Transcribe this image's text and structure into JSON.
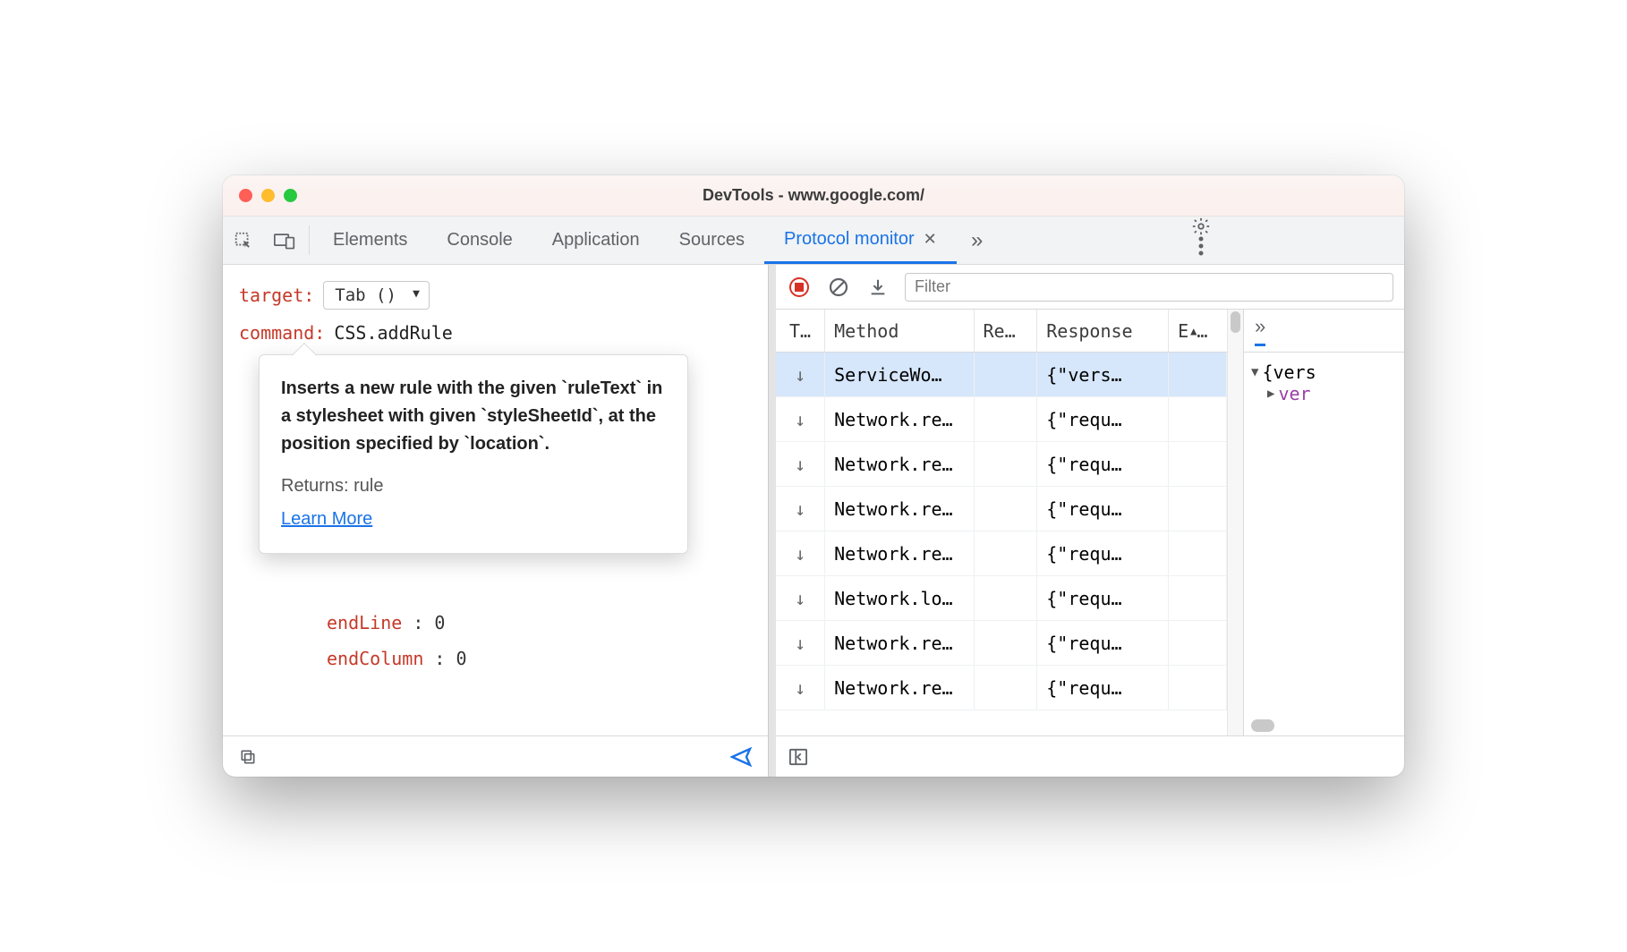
{
  "window": {
    "title": "DevTools - www.google.com/"
  },
  "tabs": {
    "items": [
      "Elements",
      "Console",
      "Application",
      "Sources",
      "Protocol monitor"
    ],
    "active_index": 4
  },
  "left": {
    "target_label": "target",
    "target_value": "Tab ()",
    "command_label": "command",
    "command_value": "CSS.addRule",
    "tooltip": {
      "desc": "Inserts a new rule with the given `ruleText` in a stylesheet with given `styleSheetId`, at the position specified by `location`.",
      "returns_label": "Returns: rule",
      "learn_more": "Learn More"
    },
    "params": [
      {
        "key": "endLine",
        "value": "0"
      },
      {
        "key": "endColumn",
        "value": "0"
      }
    ]
  },
  "right": {
    "filter_placeholder": "Filter",
    "columns": {
      "t": "T…",
      "method": "Method",
      "re": "Re…",
      "response": "Response",
      "e": "E"
    },
    "rows": [
      {
        "dir": "↓",
        "method": "ServiceWo…",
        "re": "",
        "response": "{\"vers…",
        "e": ""
      },
      {
        "dir": "↓",
        "method": "Network.re…",
        "re": "",
        "response": "{\"requ…",
        "e": ""
      },
      {
        "dir": "↓",
        "method": "Network.re…",
        "re": "",
        "response": "{\"requ…",
        "e": ""
      },
      {
        "dir": "↓",
        "method": "Network.re…",
        "re": "",
        "response": "{\"requ…",
        "e": ""
      },
      {
        "dir": "↓",
        "method": "Network.re…",
        "re": "",
        "response": "{\"requ…",
        "e": ""
      },
      {
        "dir": "↓",
        "method": "Network.lo…",
        "re": "",
        "response": "{\"requ…",
        "e": ""
      },
      {
        "dir": "↓",
        "method": "Network.re…",
        "re": "",
        "response": "{\"requ…",
        "e": ""
      },
      {
        "dir": "↓",
        "method": "Network.re…",
        "re": "",
        "response": "{\"requ…",
        "e": ""
      }
    ],
    "detail": {
      "root": "{vers",
      "child_key": "ver"
    }
  }
}
